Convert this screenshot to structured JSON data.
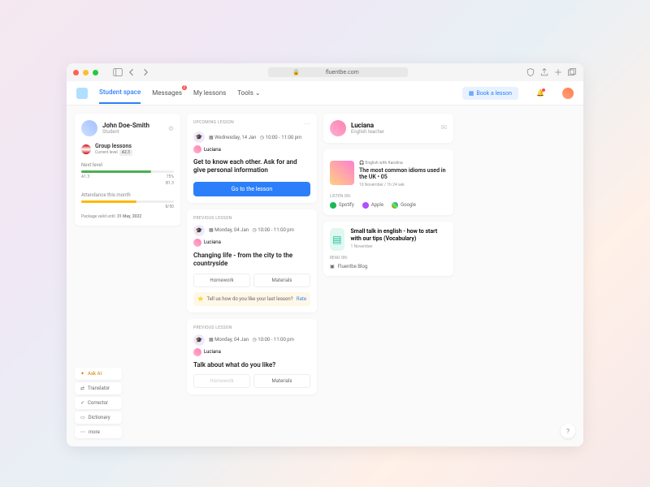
{
  "browser": {
    "url": "fluentbe.com"
  },
  "nav": {
    "tabs": [
      "Student space",
      "Messages",
      "My lessons",
      "Tools"
    ],
    "messages_badge": "2",
    "book_label": "Book a lesson"
  },
  "profile": {
    "name": "John Doe-Smith",
    "role": "Student",
    "group_label": "Group lessons",
    "current_level_label": "Current level",
    "current_level": "A2.3",
    "next_label": "Next level",
    "next_pct": "75%",
    "scale_from": "A1.3",
    "scale_to": "B1.3",
    "attendance_label": "Attendance this month",
    "attendance_val": "8/50",
    "valid_label": "Package valid until:",
    "valid_date": "31 May, 2022"
  },
  "upcoming": {
    "tag": "UPCOMING LESSON",
    "date": "Wednesday, 14 Jan",
    "time": "10:00 - 11:00 pm",
    "tutor": "Luciana",
    "title": "Get to know each other. Ask for and give personal information",
    "cta": "Go to the lesson"
  },
  "previous1": {
    "tag": "PREVIOUS LESSON",
    "date": "Monday, 04 Jan",
    "time": "10:00 - 11:00 pm",
    "tutor": "Luciana",
    "title": "Changing life - from the city to the countryside",
    "homework": "Homework",
    "materials": "Materials",
    "feedback": "Tell us how do you like your last lesson?",
    "rate": "Rate"
  },
  "previous2": {
    "tag": "PREVIOUS LESSON",
    "date": "Monday, 04 Jan",
    "time": "10:00 - 11:00 pm",
    "tutor": "Luciana",
    "title": "Talk about what do you like?",
    "homework": "Homework",
    "materials": "Materials"
  },
  "tutor": {
    "name": "Luciana",
    "role": "English teacher"
  },
  "podcast": {
    "tag": "English with Karolina",
    "title": "The most common idioms used in the UK • 05",
    "meta": "10 November  /  1h 24 sek",
    "listen_label": "LISTEN ON:",
    "providers": [
      "Spotify",
      "Apple",
      "Google"
    ]
  },
  "blog": {
    "title": "Small talk in english - how to start with our tips (Vocabulary)",
    "date": "1 November",
    "read_label": "READ ON:",
    "link": "Fluentbe Blog"
  },
  "tools": [
    "Ask AI",
    "Translator",
    "Corrector",
    "Dictionary",
    "more"
  ],
  "help": "?"
}
